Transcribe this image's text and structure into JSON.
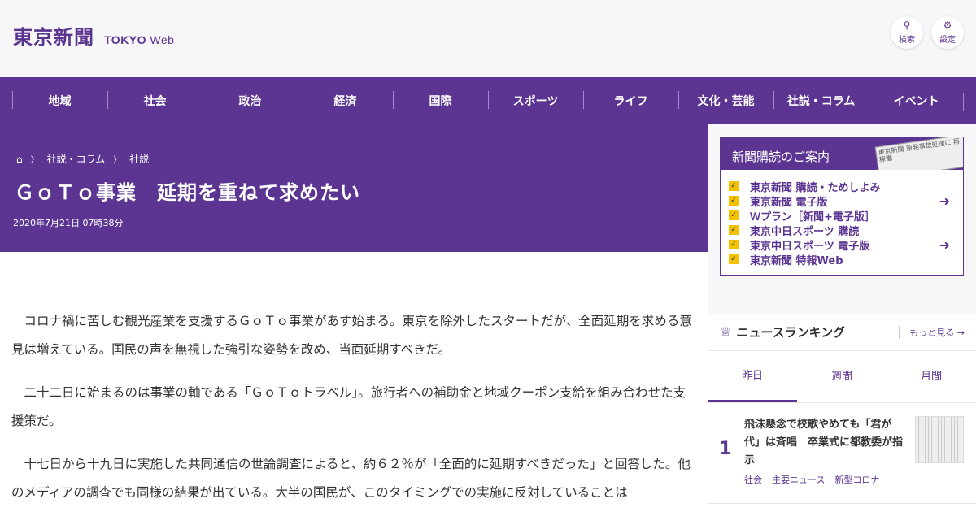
{
  "header": {
    "logo_jp": "東京新聞",
    "logo_en_bold": "TOKYO",
    "logo_en_web": "Web",
    "search_label": "検索",
    "settings_label": "設定"
  },
  "nav": [
    "地域",
    "社会",
    "政治",
    "経済",
    "国際",
    "スポーツ",
    "ライフ",
    "文化・芸能",
    "社説・コラム",
    "イベント"
  ],
  "breadcrumb": {
    "home_icon": "home-icon",
    "items": [
      "社説・コラム",
      "社説"
    ]
  },
  "article": {
    "title": "ＧｏＴｏ事業　延期を重ねて求めたい",
    "date": "2020年7月21日 07時38分",
    "paragraphs": [
      "コロナ禍に苦しむ観光産業を支援するＧｏＴｏ事業があす始まる。東京を除外したスタートだが、全面延期を求める意見は増えている。国民の声を無視した強引な姿勢を改め、当面延期すべきだ。",
      "二十二日に始まるのは事業の軸である「ＧｏＴｏトラベル」。旅行者への補助金と地域クーポン支給を組み合わせた支援策だ。",
      "十七日から十九日に実施した共同通信の世論調査によると、約６２％が「全面的に延期すべきだった」と回答した。他のメディアの調査でも同様の結果が出ている。大半の国民が、このタイミングでの実施に反対していることは"
    ]
  },
  "subscription": {
    "heading": "新聞購読のご案内",
    "items": [
      "東京新聞 購読・ためしよみ",
      "東京新聞 電子版",
      "Ｗプラン［新聞+電子版］",
      "東京中日スポーツ 購読",
      "東京中日スポーツ 電子版",
      "東京新聞 特報Web"
    ],
    "paper_text": "東京新聞 原発事故処理に 再稼働"
  },
  "ranking": {
    "title": "ニュースランキング",
    "more": "もっと見る",
    "tabs": [
      "昨日",
      "週間",
      "月間"
    ],
    "items": [
      {
        "rank": "1",
        "text": "飛沫懸念で校歌やめても「君が代」は斉唱　卒業式に都教委が指示",
        "tags": [
          "社会",
          "主要ニュース",
          "新型コロナ"
        ]
      }
    ]
  }
}
